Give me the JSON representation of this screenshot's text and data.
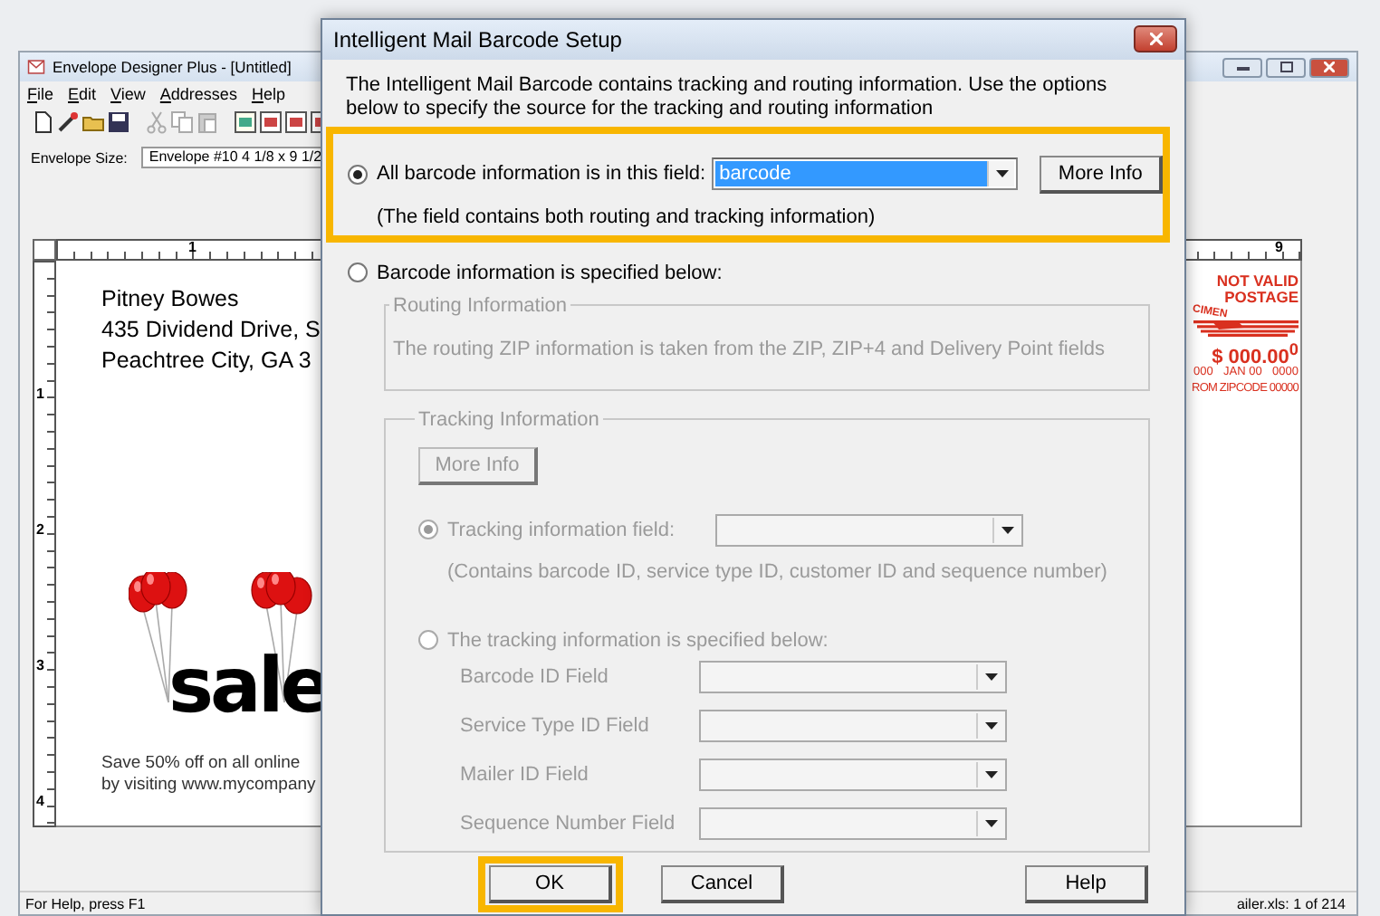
{
  "app_window": {
    "title": "Envelope Designer Plus - [Untitled]",
    "menu": [
      "File",
      "Edit",
      "View",
      "Addresses",
      "Help"
    ],
    "envelope_size": {
      "label": "Envelope Size:",
      "value": "Envelope #10 4 1/8 x 9 1/2"
    },
    "ruler": {
      "horizontal": [
        "1",
        "9"
      ],
      "vertical": [
        "1",
        "2",
        "3",
        "4"
      ]
    },
    "envelope": {
      "return_address": [
        "Pitney Bowes",
        "435 Dividend Drive, S",
        "Peachtree City, GA 3"
      ],
      "promo": {
        "headline": "sale",
        "lines": [
          "Save 50% off on all online",
          "by visiting www.mycompany"
        ]
      },
      "postage_meter": {
        "stamp": "CIMEN",
        "heading": [
          "NOT VALID",
          "POSTAGE"
        ],
        "amount": "$ 000.00$^{0}$",
        "date_row": [
          "000",
          "JAN 00",
          "0000"
        ],
        "zip_row": "ROM ZIPCODE 00000"
      }
    },
    "status_bar": {
      "left": "For Help, press F1",
      "right": "ailer.xls: 1 of 214"
    }
  },
  "dialog": {
    "title": "Intelligent Mail Barcode Setup",
    "intro": "The Intelligent Mail Barcode contains tracking and routing information. Use the options below to specify the source for the tracking and routing information",
    "source_options": [
      {
        "kind": "field",
        "label": "All barcode information is in this field:",
        "selected": true,
        "highlighted": true,
        "field": {
          "value": "barcode"
        },
        "button": "More Info",
        "note": "(The field contains both routing and tracking information)"
      },
      {
        "kind": "specified",
        "label": "Barcode information is specified below:",
        "selected": false,
        "highlighted": false
      }
    ],
    "routing_group": {
      "title": "Routing Information",
      "text": "The routing ZIP information is taken from the ZIP, ZIP+4 and Delivery Point fields",
      "disabled": true
    },
    "tracking_group": {
      "title": "Tracking Information",
      "disabled": true,
      "button": "More Info",
      "options": [
        {
          "kind": "field",
          "label": "Tracking information field:",
          "selected": true,
          "note": "(Contains barcode ID, service type ID, customer ID and sequence number)"
        },
        {
          "kind": "specified",
          "label": "The tracking information is specified below:",
          "selected": false,
          "fields": [
            {
              "label": "Barcode ID Field"
            },
            {
              "label": "Service Type ID Field"
            },
            {
              "label": "Mailer ID Field"
            },
            {
              "label": "Sequence Number Field"
            }
          ]
        }
      ]
    },
    "buttons": [
      {
        "label": "OK",
        "highlighted": true
      },
      {
        "label": "Cancel",
        "highlighted": false
      },
      {
        "label": "Help",
        "highlighted": false
      }
    ]
  }
}
